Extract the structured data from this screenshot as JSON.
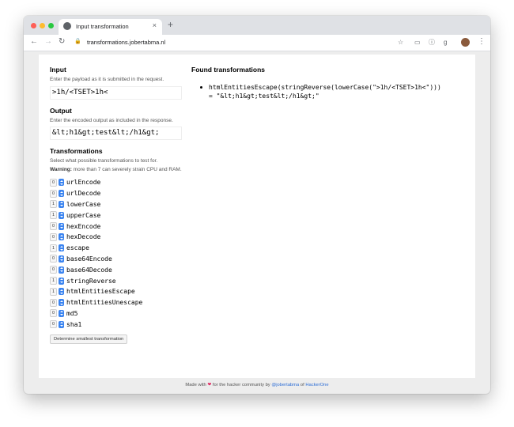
{
  "browser": {
    "tab_title": "Input transformation",
    "url": "transformations.jobertabma.nl",
    "new_tab_label": "+",
    "close_label": "×",
    "colors": {
      "close": "#fe5f57",
      "minimize": "#febc2e",
      "maximize": "#28c840"
    }
  },
  "input": {
    "heading": "Input",
    "description": "Enter the payload as it is submitted in the request.",
    "value": ">1h/<TSET>1h<"
  },
  "output": {
    "heading": "Output",
    "description": "Enter the encoded output as included in the response.",
    "value": "&lt;h1&gt;test&lt;/h1&gt;"
  },
  "transformations": {
    "heading": "Transformations",
    "description": "Select what possible transformations to test for.",
    "warning_label": "Warning:",
    "warning_text": " more than 7 can severely strain CPU and RAM.",
    "items": [
      {
        "count": "0",
        "name": "urlEncode"
      },
      {
        "count": "0",
        "name": "urlDecode"
      },
      {
        "count": "1",
        "name": "lowerCase"
      },
      {
        "count": "1",
        "name": "upperCase"
      },
      {
        "count": "0",
        "name": "hexEncode"
      },
      {
        "count": "0",
        "name": "hexDecode"
      },
      {
        "count": "1",
        "name": "escape"
      },
      {
        "count": "0",
        "name": "base64Encode"
      },
      {
        "count": "0",
        "name": "base64Decode"
      },
      {
        "count": "1",
        "name": "stringReverse"
      },
      {
        "count": "1",
        "name": "htmlEntitiesEscape"
      },
      {
        "count": "0",
        "name": "htmlEntitiesUnescape"
      },
      {
        "count": "0",
        "name": "md5"
      },
      {
        "count": "0",
        "name": "sha1"
      }
    ],
    "button_label": "Determine smallest transformation"
  },
  "found": {
    "heading": "Found transformations",
    "result_line1": "htmlEntitiesEscape(stringReverse(lowerCase(\">1h/<TSET>1h<\")))",
    "result_line2": "= \"&lt;h1&gt;test&lt;/h1&gt;\""
  },
  "footer": {
    "made_with": "Made with",
    "heart": "❤",
    "for_text": "for the hacker community by",
    "author": "@jobertabma",
    "of_text": "of",
    "company": "HackerOne"
  },
  "colors": {
    "accent": "#3b84f0",
    "link": "#2f6fd6",
    "heart": "#e0245e"
  }
}
